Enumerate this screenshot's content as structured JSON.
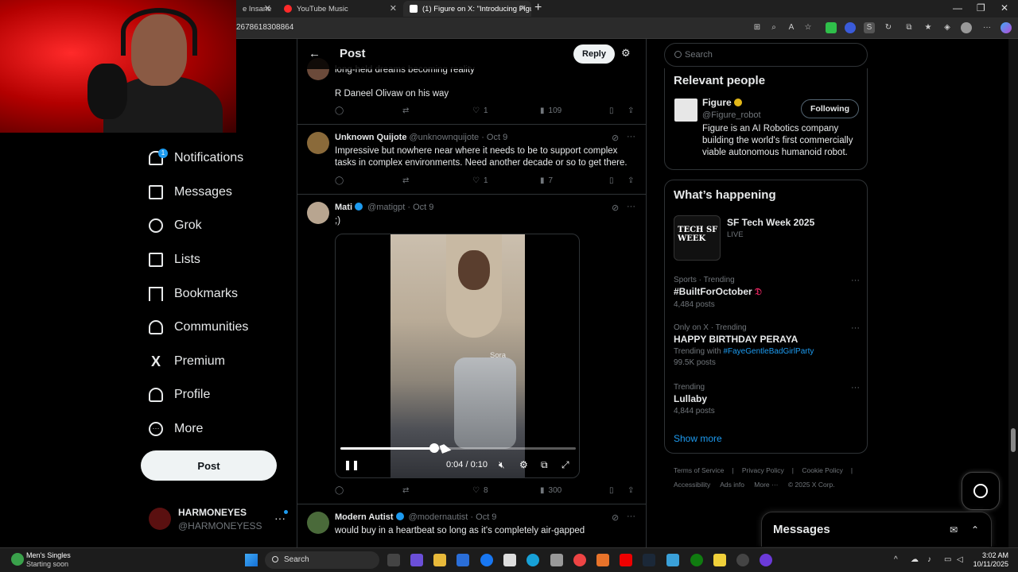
{
  "browser": {
    "tabs": [
      {
        "label": "e Insane",
        "active": false
      },
      {
        "label": "YouTube Music",
        "active": false
      },
      {
        "label": "(1) Figure on X: \"Introducing Figu",
        "active": true
      }
    ],
    "url_fragment": "2678618308864"
  },
  "nav": {
    "notifications": "Notifications",
    "notifications_badge": "1",
    "messages": "Messages",
    "grok": "Grok",
    "lists": "Lists",
    "bookmarks": "Bookmarks",
    "communities": "Communities",
    "premium": "Premium",
    "profile": "Profile",
    "more": "More",
    "post_button": "Post"
  },
  "account": {
    "name": "HARMONEYES",
    "handle": "@HARMONEYESS"
  },
  "main": {
    "title": "Post",
    "reply_button": "Reply"
  },
  "tweets": [
    {
      "body_lines": [
        "long-held dreams becoming reality",
        "R Daneel Olivaw on his way"
      ],
      "likes": "1",
      "views": "109"
    },
    {
      "name": "Unknown Quijote",
      "handle": "@unknownquijote",
      "date": "· Oct 9",
      "body": "Impressive but nowhere near where it needs to be to support complex tasks in complex environments. Need another decade or so to get there.",
      "likes": "1",
      "views": "7"
    },
    {
      "name": "Mati",
      "handle": "@matigpt",
      "date": "· Oct 9",
      "body": ";)",
      "likes": "8",
      "views": "300",
      "video": {
        "watermark": "Sora",
        "time": "0:04 / 0:10",
        "progress": 0.4
      }
    },
    {
      "name": "Modern Autist",
      "handle": "@modernautist",
      "date": "· Oct 9",
      "body": "would buy in a heartbeat so long as it's completely air-gapped"
    }
  ],
  "sidebar": {
    "search_placeholder": "Search",
    "relevant_people": {
      "title": "Relevant people",
      "name": "Figure",
      "handle": "@Figure_robot",
      "follow_label": "Following",
      "bio": "Figure is an AI Robotics company building the world's first commercially viable autonomous humanoid robot."
    },
    "whats_happening": {
      "title": "What’s happening",
      "event": {
        "title": "SF Tech Week 2025",
        "status": "LIVE",
        "thumb_text": "TECH SF WEEK"
      },
      "trends": [
        {
          "category": "Sports · Trending",
          "name": "#BuiltForOctober",
          "sub": "4,484 posts"
        },
        {
          "category": "Only on X · Trending",
          "name": "HAPPY BIRTHDAY PERAYA",
          "trending_with_label": "Trending with",
          "trending_with_link": "#FayeGentleBadGirlParty",
          "sub": "99.5K posts"
        },
        {
          "category": "Trending",
          "name": "Lullaby",
          "sub": "4,844 posts"
        }
      ],
      "show_more": "Show more"
    },
    "footer": {
      "terms": "Terms of Service",
      "privacy": "Privacy Policy",
      "cookie": "Cookie Policy",
      "accessibility": "Accessibility",
      "ads": "Ads info",
      "more": "More ···",
      "copyright": "© 2025 X Corp."
    },
    "messages_drawer": "Messages"
  },
  "taskbar": {
    "weather_title": "Men's Singles",
    "weather_sub": "Starting soon",
    "search": "Search",
    "time": "3:02 AM",
    "date": "10/11/2025"
  },
  "colors": {
    "accent": "#1d9bf0",
    "background": "#000000",
    "border": "#2f3336",
    "muted": "#71767b"
  }
}
